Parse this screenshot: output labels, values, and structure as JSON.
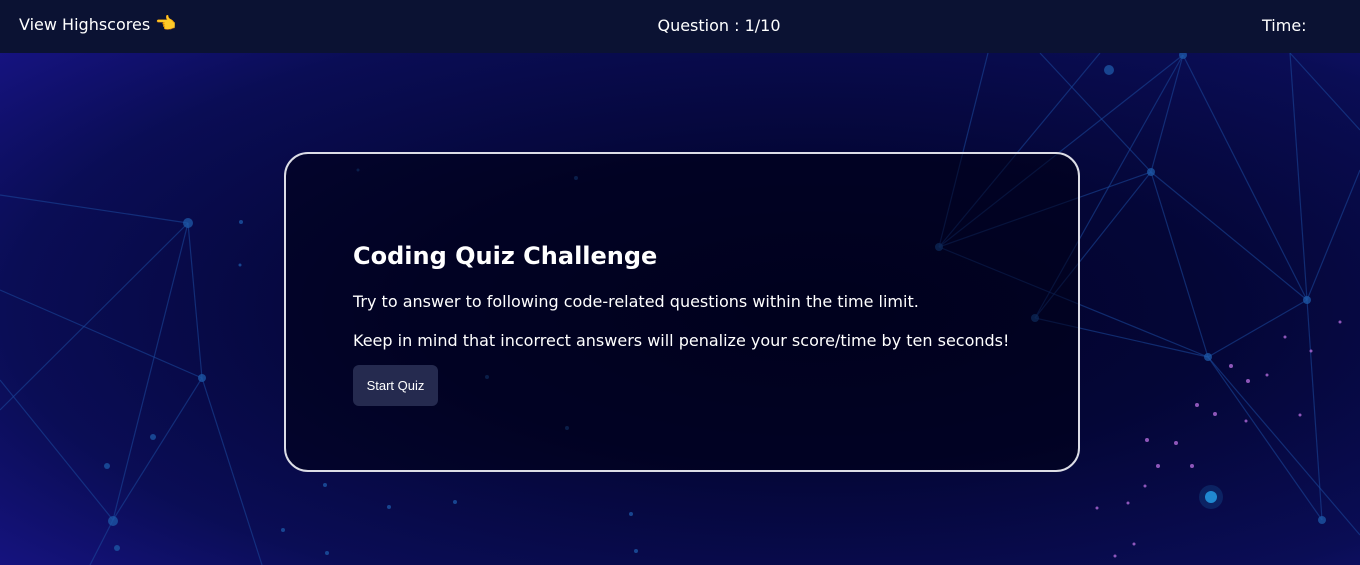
{
  "header": {
    "highscores_label": "View Highscores",
    "highscores_icon": "pointing-hand-icon",
    "question_counter": "Question : 1/10",
    "timer_label": "Time:"
  },
  "quiz_intro": {
    "title": "Coding Quiz Challenge",
    "line1": "Try to answer to following code-related questions within the time limit.",
    "line2": "Keep in mind that incorrect answers will penalize your score/time by ten seconds!",
    "start_button": "Start Quiz"
  },
  "colors": {
    "header_background": "#0b1233",
    "page_background": "#040637",
    "button_background": "#252a4f",
    "card_border": "#dcdde6"
  }
}
